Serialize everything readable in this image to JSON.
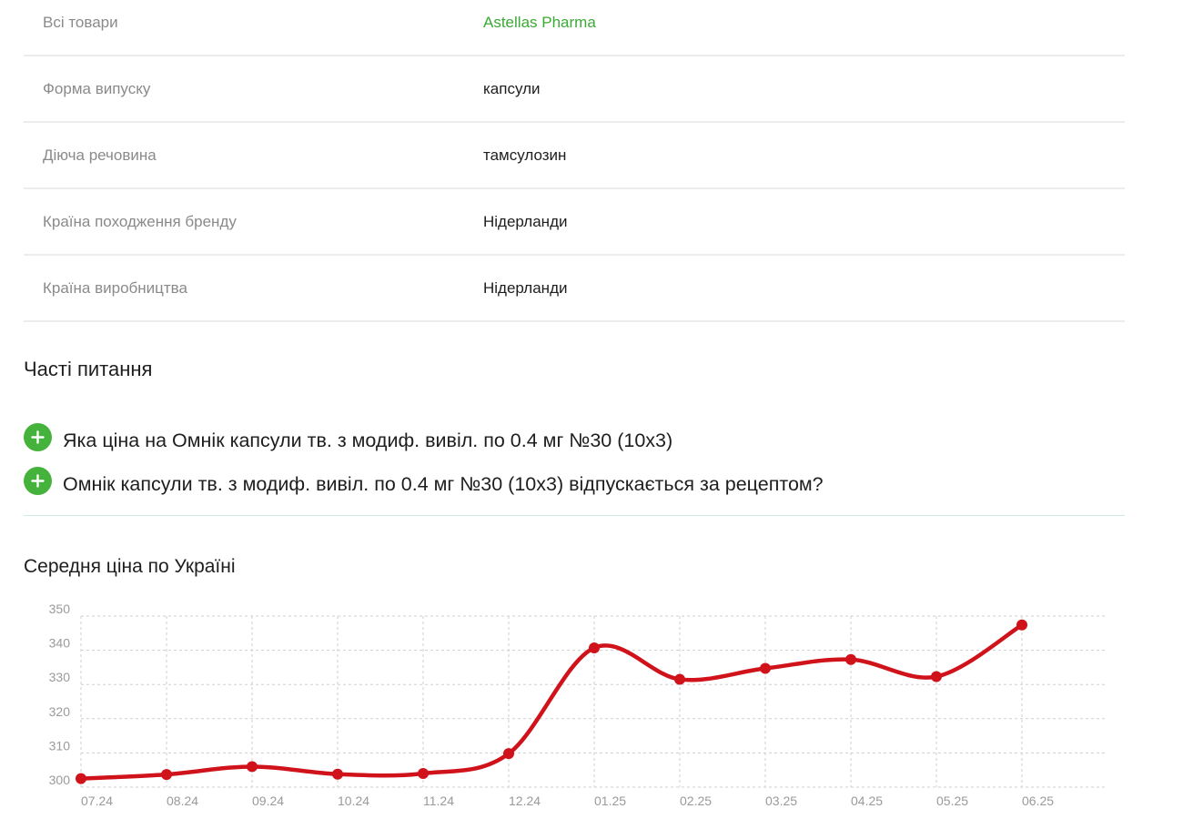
{
  "attributes": [
    {
      "label": "Всі товари",
      "value": "Astellas Pharma",
      "link": true
    },
    {
      "label": "Форма випуску",
      "value": "капсули",
      "link": false
    },
    {
      "label": "Діюча речовина",
      "value": "тамсулозин",
      "link": false
    },
    {
      "label": "Країна походження бренду",
      "value": "Нідерланди",
      "link": false
    },
    {
      "label": "Країна виробництва",
      "value": "Нідерланди",
      "link": false
    }
  ],
  "faq": {
    "title": "Часті питання",
    "items": [
      {
        "question": "Яка ціна на Омнік капсули тв. з модиф. вивіл. по 0.4 мг №30 (10х3)",
        "icon": "plus-icon"
      },
      {
        "question": "Омнік капсули тв. з модиф. вивіл. по 0.4 мг №30 (10х3) відпускається за рецептом?",
        "icon": "plus-icon"
      }
    ]
  },
  "price_chart": {
    "title": "Середня ціна по Україні"
  },
  "colors": {
    "accent_green": "#45b23b",
    "link_green": "#3aa935",
    "series_red": "#d0121a"
  },
  "chart_data": {
    "type": "line",
    "title": "",
    "xlabel": "",
    "ylabel": "",
    "categories": [
      "07.24",
      "08.24",
      "09.24",
      "10.24",
      "11.24",
      "12.24",
      "01.25",
      "02.25",
      "03.25",
      "04.25",
      "05.25",
      "06.25"
    ],
    "series": [
      {
        "values": [
          302.5,
          303.7,
          306.0,
          303.8,
          304.0,
          309.8,
          340.7,
          331.5,
          334.7,
          337.3,
          332.3,
          347.4
        ]
      }
    ],
    "ylim": [
      300,
      350
    ],
    "yticks": [
      300,
      310,
      320,
      330,
      340,
      350
    ],
    "grid": true,
    "smooth": true,
    "legend": "none"
  }
}
